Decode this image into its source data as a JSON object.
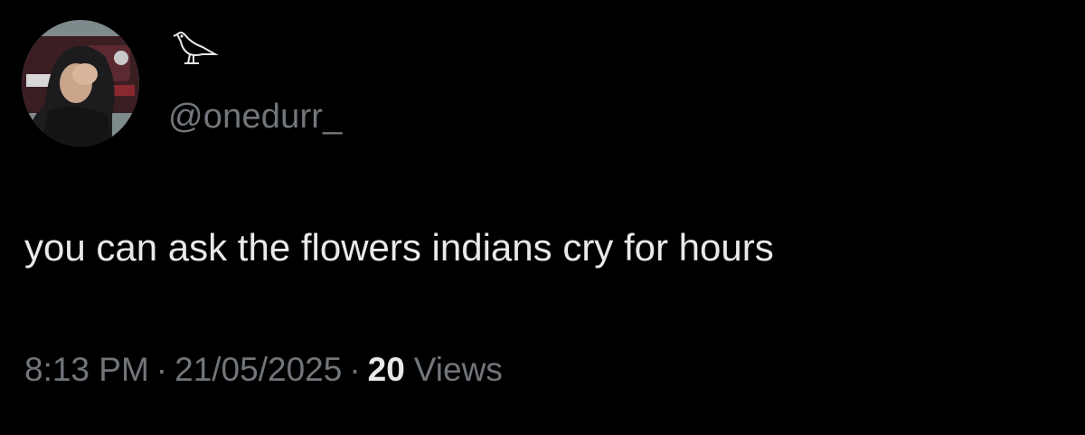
{
  "tweet": {
    "author": {
      "handle": "@onedurr_",
      "display_name_icon": "bird-icon",
      "avatar_icon": "profile-photo"
    },
    "text": "you can ask the flowers indians cry for hours",
    "time": "8:13 PM",
    "separator": "·",
    "date": "21/05/2025",
    "views_count": "20",
    "views_label": "Views"
  },
  "colors": {
    "background": "#000000",
    "primary_text": "#e7e9ea",
    "secondary_text": "#71767b"
  }
}
